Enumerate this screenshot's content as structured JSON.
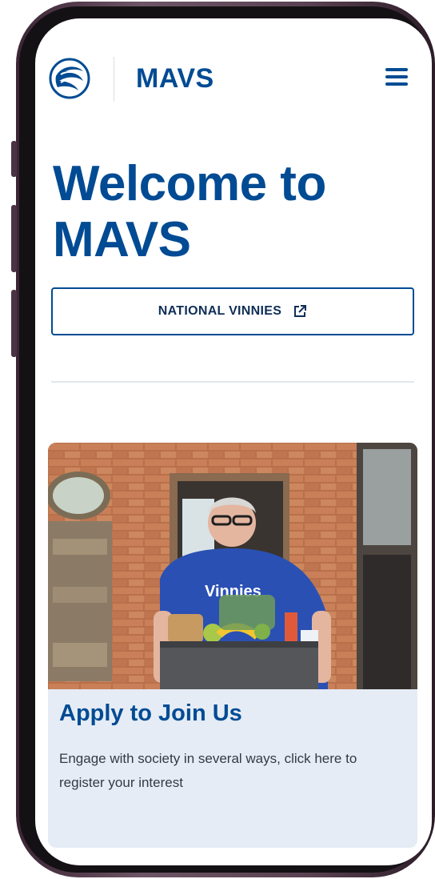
{
  "header": {
    "brand": "MAVS",
    "logo_icon": "vinnies-logo-icon",
    "menu_icon": "hamburger-menu-icon"
  },
  "hero": {
    "title": "Welcome to MAVS"
  },
  "external_link": {
    "label": "NATIONAL VINNIES",
    "icon": "external-link-icon"
  },
  "card": {
    "image_alt": "Volunteer in a Vinnies shirt holding a box of groceries",
    "image_shirt_text": "Vinnies",
    "title": "Apply to Join Us",
    "text": "Engage with society in several ways, click here to register your interest"
  },
  "colors": {
    "brand_blue": "#004b93",
    "card_background": "#e5ecf5",
    "phone_frame": "#5a4152"
  }
}
